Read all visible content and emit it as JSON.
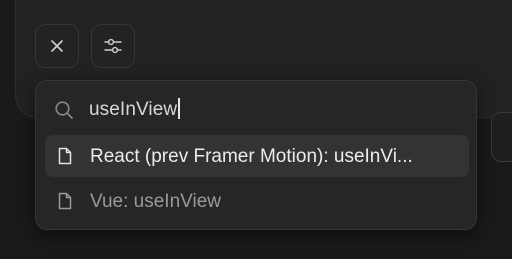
{
  "toolbar": {
    "close_icon": "close-icon",
    "filter_icon": "sliders-icon"
  },
  "search": {
    "icon": "search-icon",
    "value": "useInView"
  },
  "results": [
    {
      "icon": "document-icon",
      "label": "React (prev Framer Motion): useInVi...",
      "selected": true
    },
    {
      "icon": "document-icon",
      "label": "Vue: useInView",
      "selected": false
    }
  ],
  "colors": {
    "background": "#1a1a1a",
    "popup": "#262626",
    "selected_row": "#333333",
    "text_primary": "#ececec",
    "text_secondary": "#9a9a9a"
  }
}
